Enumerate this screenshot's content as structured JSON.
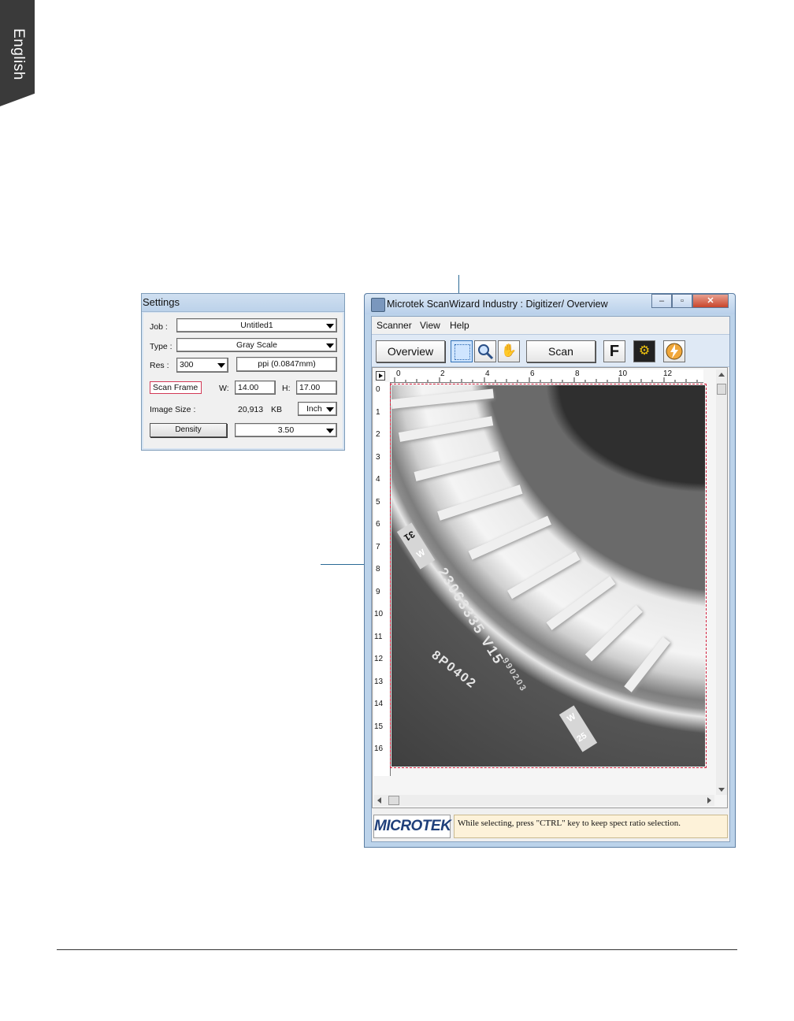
{
  "language_tab": "English",
  "settings": {
    "title": "Settings",
    "job_label": "Job :",
    "job_value": "Untitled1",
    "type_label": "Type :",
    "type_value": "Gray Scale",
    "res_label": "Res :",
    "res_value": "300",
    "res_unit": "ppi (0.0847mm)",
    "scan_frame": "Scan Frame",
    "w_label": "W:",
    "w_value": "14.00",
    "h_label": "H:",
    "h_value": "17.00",
    "image_size_label": "Image Size :",
    "image_size_value": "20,913",
    "image_size_unit": "KB",
    "unit_value": "Inch",
    "density_button": "Density",
    "density_value": "3.50"
  },
  "window": {
    "title": "Microtek ScanWizard Industry : Digitizer/ Overview",
    "menu": [
      "Scanner",
      "View",
      "Help"
    ],
    "toolbar": {
      "overview": "Overview",
      "scan": "Scan",
      "f_button": "F",
      "icons": [
        "select-frame-icon",
        "zoom-icon",
        "hand-icon",
        "settings-gear-icon",
        "express-lightning-icon"
      ]
    },
    "ruler_top": [
      "0",
      "2",
      "4",
      "6",
      "8",
      "10",
      "12"
    ],
    "ruler_left": [
      "0",
      "1",
      "2",
      "3",
      "4",
      "5",
      "6",
      "7",
      "8",
      "9",
      "10",
      "11",
      "12",
      "13",
      "14",
      "15",
      "16"
    ],
    "image_text": {
      "serial": "23063335 V15",
      "code": "8P0402",
      "small": "990203",
      "tag1": "31",
      "tag1b": "W",
      "tag2": "W",
      "tag2b": "25"
    },
    "logo": "MICROTEK",
    "status": "While selecting, press \"CTRL\" key to keep spect ratio selection."
  }
}
